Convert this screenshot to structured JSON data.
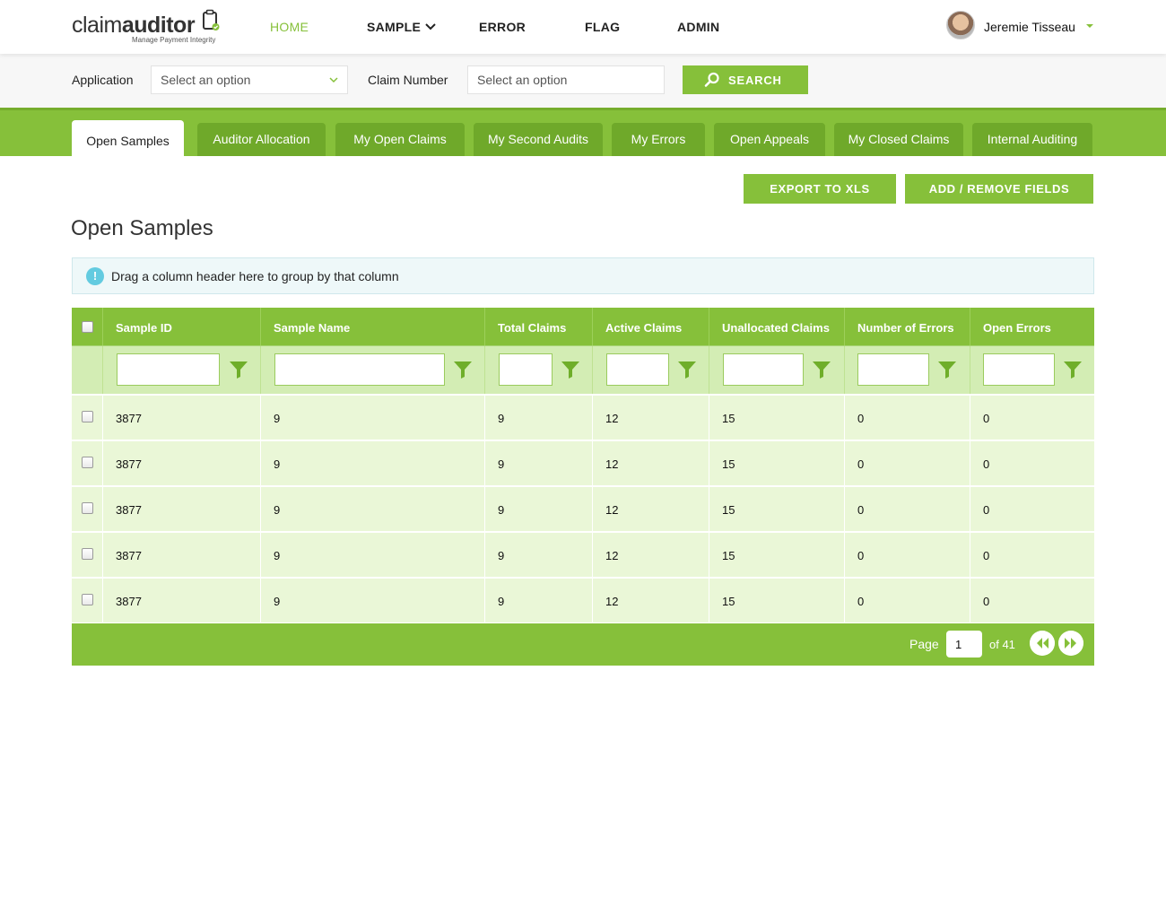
{
  "brand": {
    "name_light": "claim",
    "name_bold": "auditor",
    "tagline": "Manage Payment Integrity",
    "accent": "#86c03a"
  },
  "nav": {
    "items": [
      {
        "label": "HOME",
        "active": true
      },
      {
        "label": "SAMPLE",
        "has_dropdown": true
      },
      {
        "label": "ERROR"
      },
      {
        "label": "FLAG"
      },
      {
        "label": "ADMIN"
      }
    ]
  },
  "user": {
    "name": "Jeremie Tisseau"
  },
  "search": {
    "application_label": "Application",
    "application_value": "Select an option",
    "claim_label": "Claim Number",
    "claim_placeholder": "Select an option",
    "button_label": "SEARCH"
  },
  "tabs": [
    {
      "label": "Open Samples",
      "active": true
    },
    {
      "label": "Auditor Allocation"
    },
    {
      "label": "My Open Claims"
    },
    {
      "label": "My Second Audits"
    },
    {
      "label": "My Errors"
    },
    {
      "label": "Open Appeals"
    },
    {
      "label": "My Closed Claims"
    },
    {
      "label": "Internal Auditing"
    }
  ],
  "actions": {
    "export_label": "EXPORT TO XLS",
    "fields_label": "ADD / REMOVE FIELDS"
  },
  "page": {
    "title": "Open Samples"
  },
  "group_hint": {
    "icon": "info-icon",
    "text": "Drag a column header here to group by that column"
  },
  "grid": {
    "columns": [
      "Sample ID",
      "Sample Name",
      "Total Claims",
      "Active Claims",
      "Unallocated Claims",
      "Number of Errors",
      "Open Errors"
    ],
    "rows": [
      [
        "3877",
        "9",
        "9",
        "12",
        "15",
        "0",
        "0"
      ],
      [
        "3877",
        "9",
        "9",
        "12",
        "15",
        "0",
        "0"
      ],
      [
        "3877",
        "9",
        "9",
        "12",
        "15",
        "0",
        "0"
      ],
      [
        "3877",
        "9",
        "9",
        "12",
        "15",
        "0",
        "0"
      ],
      [
        "3877",
        "9",
        "9",
        "12",
        "15",
        "0",
        "0"
      ]
    ]
  },
  "pager": {
    "page_label": "Page",
    "current_page": "1",
    "total_label": "of 41"
  }
}
